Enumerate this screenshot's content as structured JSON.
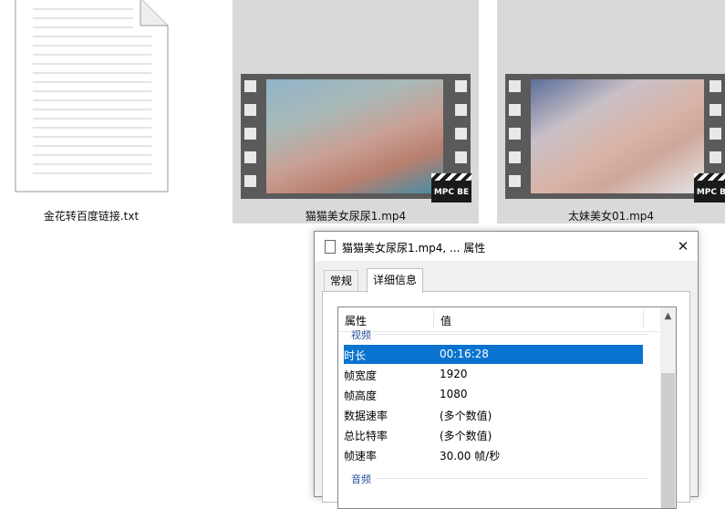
{
  "files": [
    {
      "name": "金花转百度链接.txt",
      "type": "text",
      "icon": "text-file-icon"
    },
    {
      "name": "猫猫美女尿尿1.mp4",
      "type": "video",
      "badge": "MPC BE",
      "icon": "video-thumbnail"
    },
    {
      "name": "太妹美女01.mp4",
      "type": "video",
      "badge": "MPC BE",
      "icon": "video-thumbnail"
    }
  ],
  "dialog": {
    "title": "猫猫美女尿尿1.mp4, ... 属性",
    "close": "✕",
    "tabs": [
      {
        "label": "常规"
      },
      {
        "label": "详细信息"
      }
    ],
    "active_tab": "详细信息",
    "columns": {
      "property": "属性",
      "value": "值"
    },
    "group_video": "视频",
    "group_audio": "音频",
    "rows": [
      {
        "key": "时长",
        "value": "00:16:28",
        "selected": true
      },
      {
        "key": "帧宽度",
        "value": "1920"
      },
      {
        "key": "帧高度",
        "value": "1080"
      },
      {
        "key": "数据速率",
        "value": "(多个数值)"
      },
      {
        "key": "总比特率",
        "value": "(多个数值)"
      },
      {
        "key": "帧速率",
        "value": "30.00 帧/秒"
      }
    ]
  },
  "colors": {
    "selection": "#0a73d0",
    "dialog_bg": "#f0f0f0",
    "thumb_bg": "#d9d9d9"
  }
}
